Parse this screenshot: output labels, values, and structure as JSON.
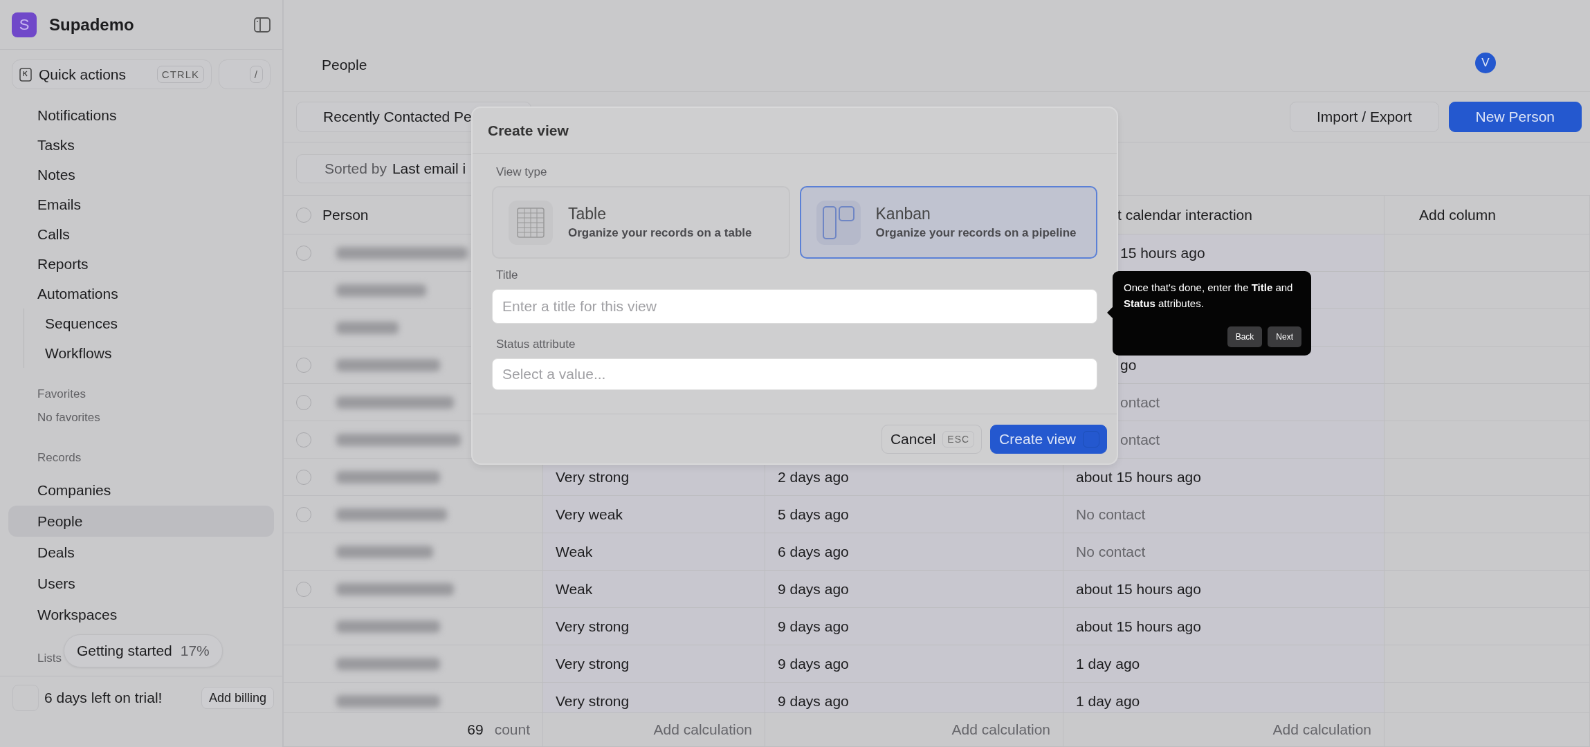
{
  "workspace": {
    "initial": "S",
    "name": "Supademo"
  },
  "quick_actions": {
    "label": "Quick actions",
    "shortcut": "CTRLK",
    "search_shortcut": "/"
  },
  "nav": [
    {
      "label": "Notifications"
    },
    {
      "label": "Tasks"
    },
    {
      "label": "Notes"
    },
    {
      "label": "Emails"
    },
    {
      "label": "Calls"
    },
    {
      "label": "Reports"
    },
    {
      "label": "Automations",
      "children": [
        {
          "label": "Sequences"
        },
        {
          "label": "Workflows"
        }
      ]
    }
  ],
  "favorites": {
    "heading": "Favorites",
    "empty_text": "No favorites"
  },
  "records": {
    "heading": "Records",
    "items": [
      {
        "label": "Companies",
        "selected": false
      },
      {
        "label": "People",
        "selected": true
      },
      {
        "label": "Deals",
        "selected": false
      },
      {
        "label": "Users",
        "selected": false
      },
      {
        "label": "Workspaces",
        "selected": false
      }
    ]
  },
  "lists": {
    "heading": "Lists"
  },
  "getting_started": {
    "label": "Getting started",
    "percent": "17%"
  },
  "trial": {
    "text": "6 days left on trial!",
    "button": "Add billing"
  },
  "header": {
    "breadcrumb": "People",
    "avatar": "V"
  },
  "views": {
    "current": "Recently Contacted Pe",
    "actions": [
      {
        "label": "Import / Export",
        "kind": "secondary"
      },
      {
        "label": "New Person",
        "kind": "primary"
      }
    ]
  },
  "sort": {
    "label": "Sorted by",
    "value": "Last email i"
  },
  "table": {
    "header": {
      "select_all_checked": false,
      "person": "Person",
      "column_4": "t calendar interaction",
      "add_column": "Add column"
    },
    "rows": [
      {
        "kind": "with-checkbox",
        "checked": false,
        "column_4": {
          "text": "15 hours ago",
          "muted": false,
          "cut": true
        }
      },
      {
        "kind": "plain"
      },
      {
        "kind": "plain"
      },
      {
        "kind": "with-checkbox",
        "checked": false,
        "column_4": {
          "text": "go",
          "muted": false,
          "cut": true
        }
      },
      {
        "kind": "with-checkbox",
        "checked": false,
        "column_4": {
          "text": "ontact",
          "muted": true,
          "cut": true
        }
      },
      {
        "kind": "with-checkbox",
        "checked": false,
        "column_4": {
          "text": "ontact",
          "muted": true,
          "cut": true
        }
      },
      {
        "kind": "with-checkbox",
        "checked": false,
        "column_2": "Very strong",
        "column_3": "2 days ago",
        "column_4": {
          "text": "about 15 hours ago",
          "muted": false,
          "cut": false
        }
      },
      {
        "kind": "with-checkbox",
        "checked": false,
        "column_2": "Very weak",
        "column_3": "5 days ago",
        "column_4": {
          "text": "No contact",
          "muted": true,
          "cut": false
        }
      },
      {
        "kind": "plain",
        "column_2": "Weak",
        "column_3": "6 days ago",
        "column_4": {
          "text": "No contact",
          "muted": true,
          "cut": false
        }
      },
      {
        "kind": "with-checkbox",
        "checked": false,
        "column_2": "Weak",
        "column_3": "9 days ago",
        "column_4": {
          "text": "about 15 hours ago",
          "muted": false,
          "cut": false
        }
      },
      {
        "kind": "plain",
        "column_2": "Very strong",
        "column_3": "9 days ago",
        "column_4": {
          "text": "about 15 hours ago",
          "muted": false,
          "cut": false
        }
      },
      {
        "kind": "plain",
        "column_2": "Very strong",
        "column_3": "9 days ago",
        "column_4": {
          "text": "1 day ago",
          "muted": false,
          "cut": false
        }
      },
      {
        "kind": "plain",
        "column_2": "Very strong",
        "column_3": "9 days ago",
        "column_4": {
          "text": "1 day ago",
          "muted": false,
          "cut": false
        }
      }
    ],
    "footer": {
      "count": "69",
      "count_label": "count",
      "calculations": [
        "Add calculation",
        "Add calculation",
        "Add calculation"
      ]
    }
  },
  "modal": {
    "title": "Create view",
    "view_type_label": "View type",
    "view_types": [
      {
        "kind": "table",
        "title": "Table",
        "description": "Organize your records on a table",
        "selected": false
      },
      {
        "kind": "kanban",
        "title": "Kanban",
        "description": "Organize your records on a pipeline",
        "selected": true
      }
    ],
    "title_label": "Title",
    "title_placeholder": "Enter a title for this view",
    "status_label": "Status attribute",
    "status_placeholder": "Select a value...",
    "cancel": "Cancel",
    "cancel_key": "ESC",
    "submit": "Create view"
  },
  "tooltip": {
    "text": "Once that's done, enter the **Title** and **Status** attributes.",
    "buttons": [
      "Back",
      "Next"
    ]
  }
}
